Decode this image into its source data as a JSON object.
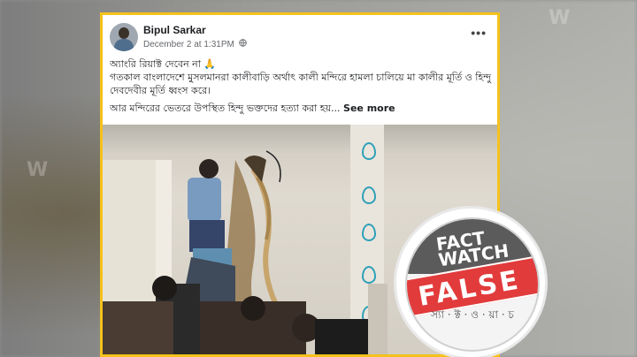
{
  "background": {
    "watermark_left": "W",
    "watermark_right": "W"
  },
  "post": {
    "author": "Bipul Sarkar",
    "timestamp": "December 2 at 1:31PM",
    "privacy_icon": "globe-icon",
    "more_icon": "more-horizontal-icon",
    "more_label": "•••",
    "lines": [
      "অ্যাংরি রিয়াক্ট দেবেন না 🙏",
      "গতকাল বাংলাদেশে মুসলমানরা কালীবাড়ি অর্থাৎ কালী মন্দিরে হামলা চালিয়ে মা কালীর মূর্তি ও হিন্দু দেবদেবীর মূর্তি ধ্বংস করে।",
      "আর মন্দিরের ভেতরে উপস্থিত হিন্দু ভক্তদের হত্যা করা হয়..."
    ],
    "see_more": "See more"
  },
  "badge": {
    "logo_line1": "FACT",
    "logo_line2": "WATCH",
    "verdict": "FALSE",
    "bottom_text": "স্যা · ক্ট · ও · য়া · চ"
  },
  "colors": {
    "frame": "#f5c21b",
    "verdict": "#e23b3b",
    "badge_dark": "#5b5b5b"
  }
}
